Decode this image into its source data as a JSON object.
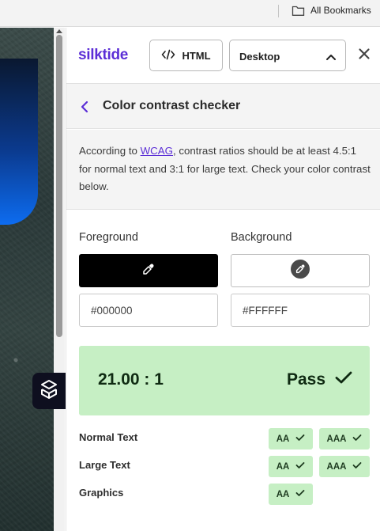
{
  "bookmarks_bar": {
    "label": "All Bookmarks"
  },
  "panel": {
    "logo": "silktide",
    "html_button_label": "HTML",
    "device_select": {
      "selected": "Desktop"
    }
  },
  "tool": {
    "title": "Color contrast checker",
    "intro_before": "According to ",
    "intro_link": "WCAG",
    "intro_after": ", contrast ratios should be at least 4.5:1 for normal text and 3:1 for large text. Check your color contrast below."
  },
  "colors": {
    "foreground": {
      "label": "Foreground",
      "value": "#000000",
      "swatch": "#000000"
    },
    "background": {
      "label": "Background",
      "value": "#FFFFFF",
      "swatch": "#FFFFFF"
    }
  },
  "result": {
    "ratio": "21.00 : 1",
    "verdict": "Pass"
  },
  "checks": [
    {
      "label": "Normal Text",
      "badges": [
        "AA",
        "AAA"
      ]
    },
    {
      "label": "Large Text",
      "badges": [
        "AA",
        "AAA"
      ]
    },
    {
      "label": "Graphics",
      "badges": [
        "AA"
      ]
    }
  ],
  "theme": {
    "brand": "#5b2ed6",
    "pass_bg": "#c6efc4",
    "pass_text": "#0f2a12"
  }
}
